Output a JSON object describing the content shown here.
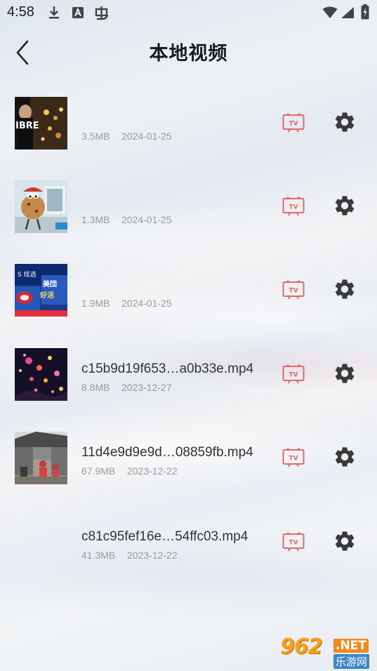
{
  "status_bar": {
    "time": "4:58",
    "icons": [
      "download-icon",
      "a-notification-icon",
      "bug-icon",
      "wifi-icon",
      "signal-icon",
      "battery-charging-icon"
    ]
  },
  "header": {
    "back_icon": "chevron-left-icon",
    "title": "本地视频"
  },
  "videos": [
    {
      "name": "",
      "size": "3.5MB",
      "date": "2024-01-25",
      "thumbnail": "concert-night-thumbnail"
    },
    {
      "name": "",
      "size": "1.3MB",
      "date": "2024-01-25",
      "thumbnail": "cartoon-cookie-thumbnail"
    },
    {
      "name": "",
      "size": "1.9MB",
      "date": "2024-01-25",
      "thumbnail": "blue-billboard-thumbnail"
    },
    {
      "name": "c15b9d19f653…a0b33e.mp4",
      "size": "8.8MB",
      "date": "2023-12-27",
      "thumbnail": "fireworks-thumbnail"
    },
    {
      "name": "11d4e9d9e9d…08859fb.mp4",
      "size": "67.9MB",
      "date": "2023-12-22",
      "thumbnail": "street-people-thumbnail"
    },
    {
      "name": "c81c95fef16e…54ffc03.mp4",
      "size": "41.3MB",
      "date": "2023-12-22",
      "thumbnail": ""
    }
  ],
  "actions": {
    "cast_icon": "tv-cast-icon",
    "settings_icon": "gear-icon"
  },
  "colors": {
    "tv_icon": "#e06a6a",
    "gear_icon": "#3a3a3a",
    "title": "#1b1b1b",
    "meta": "#9a9a9a"
  },
  "watermark": {
    "number": "962",
    "domain": ".NET",
    "site_name": "乐游网"
  }
}
